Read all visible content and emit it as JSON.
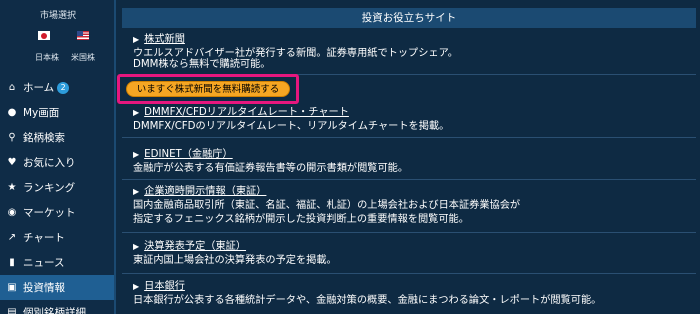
{
  "sidebar": {
    "market_label": "市場選択",
    "markets": [
      {
        "label": "日本株",
        "icon": "japan-flag-icon"
      },
      {
        "label": "米国株",
        "icon": "us-flag-icon"
      }
    ],
    "items": [
      {
        "label": "ホーム",
        "icon": "home-icon",
        "badge": "2"
      },
      {
        "label": "My画面",
        "icon": "user-icon"
      },
      {
        "label": "銘柄検索",
        "icon": "search-icon"
      },
      {
        "label": "お気に入り",
        "icon": "heart-icon"
      },
      {
        "label": "ランキング",
        "icon": "trophy-icon"
      },
      {
        "label": "マーケット",
        "icon": "globe-icon"
      },
      {
        "label": "チャート",
        "icon": "chart-icon"
      },
      {
        "label": "ニュース",
        "icon": "news-icon"
      },
      {
        "label": "投資情報",
        "icon": "monitor-icon",
        "active": true
      },
      {
        "label": "個別銘柄詳細",
        "icon": "document-icon"
      }
    ]
  },
  "main": {
    "header": "投資お役立ちサイト",
    "cta_label": "いますぐ株式新聞を無料購読する",
    "entries": [
      {
        "title": "株式新聞",
        "desc": "ウエルスアドバイザー社が発行する新聞。証券専用紙でトップシェア。",
        "desc2": "DMM株なら無料で購読可能。"
      },
      {
        "title": "DMMFX/CFDリアルタイムレート・チャート",
        "desc": "DMMFX/CFDのリアルタイムレート、リアルタイムチャートを掲載。"
      },
      {
        "title": "EDINET（金融庁）",
        "desc": "金融庁が公表する有価証券報告書等の開示書類が閲覧可能。"
      },
      {
        "title": "企業適時開示情報（東証）",
        "desc": "国内金融商品取引所（東証、名証、福証、札証）の上場会社および日本証券業協会が",
        "desc2": "指定するフェニックス銘柄が開示した投資判断上の重要情報を閲覧可能。"
      },
      {
        "title": "決算発表予定（東証）",
        "desc": "東証内国上場会社の決算発表の予定を掲載。"
      },
      {
        "title": "日本銀行",
        "desc": "日本銀行が公表する各種統計データや、金融対策の概要、金融にまつわる論文・レポートが閲覧可能。"
      }
    ]
  },
  "colors": {
    "background": "#0e2a43",
    "header_bar": "#1b4a72",
    "active_nav": "#1f5f93",
    "cta_button": "#f5a623",
    "highlight_box": "#e6177e"
  }
}
